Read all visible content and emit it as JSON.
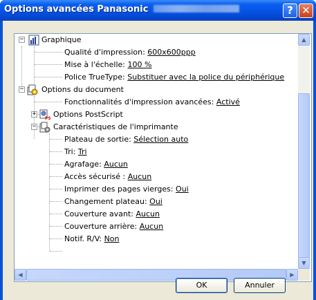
{
  "window": {
    "title": "Options avancées Panasonic",
    "help_glyph": "?",
    "close_glyph": "✕"
  },
  "tree": {
    "graphique": {
      "label": "Graphique",
      "items": [
        {
          "label": "Qualité d'impression: ",
          "value": "600x600ppp"
        },
        {
          "label": "Mise à l'échelle: ",
          "value": "100 %"
        },
        {
          "label": "Police TrueType: ",
          "value": "Substituer avec la police du périphérique"
        }
      ]
    },
    "document": {
      "label": "Options du document",
      "adv": {
        "label": "Fonctionnalités d'impression avancées: ",
        "value": "Activé"
      },
      "postscript": {
        "label": "Options PostScript"
      },
      "printer": {
        "label": "Caractéristiques de l'imprimante",
        "items": [
          {
            "label": "Plateau de sortie: ",
            "value": "Sélection auto"
          },
          {
            "label": "Tri: ",
            "value": "Tri"
          },
          {
            "label": "Agrafage: ",
            "value": "Aucun"
          },
          {
            "label": "Accès sécurisé : ",
            "value": "Aucun"
          },
          {
            "label": "Imprimer des pages vierges: ",
            "value": "Oui"
          },
          {
            "label": "Changement plateau: ",
            "value": "Oui"
          },
          {
            "label": "Couverture avant: ",
            "value": "Aucun"
          },
          {
            "label": "Couverture arrière: ",
            "value": "Aucun"
          },
          {
            "label": "Notif. R/V: ",
            "value": "Non"
          }
        ]
      }
    }
  },
  "buttons": {
    "ok": "OK",
    "cancel": "Annuler"
  },
  "colors": {
    "titlebar": "#0553e4",
    "dialog_bg": "#ece9d8",
    "border": "#7f9db9"
  }
}
